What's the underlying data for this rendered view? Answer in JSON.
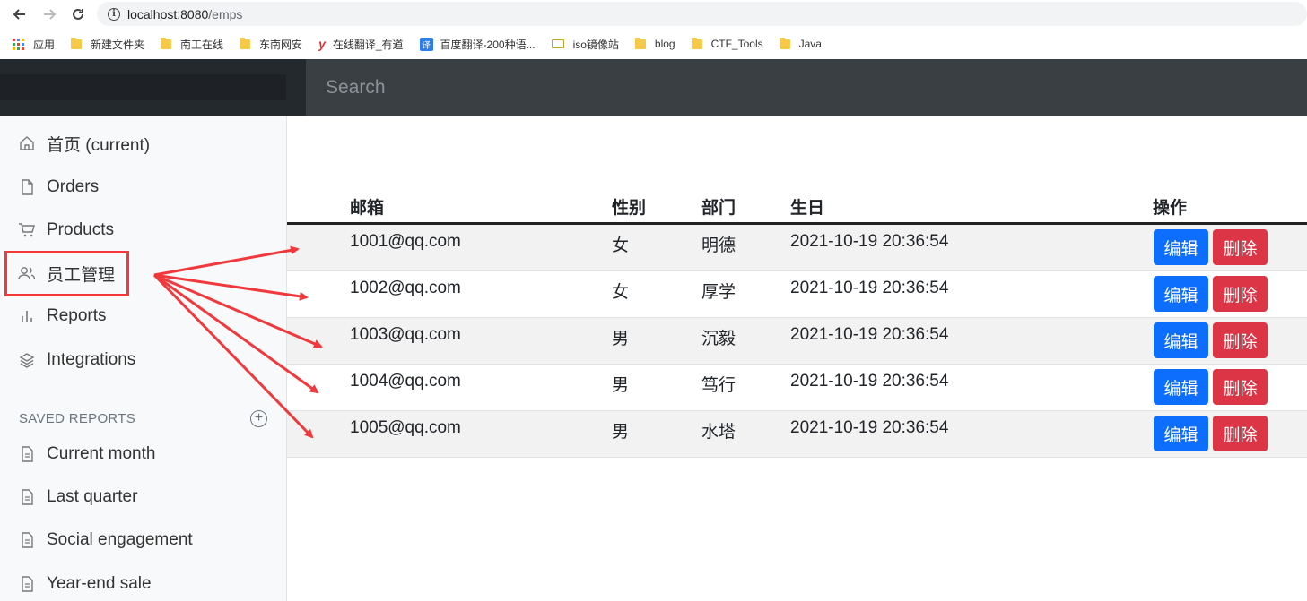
{
  "browser": {
    "url_host": "localhost:8080",
    "url_path": "/emps",
    "bookmarks": [
      {
        "label": "应用",
        "icon": "apps-grid-icon"
      },
      {
        "label": "新建文件夹",
        "icon": "folder-icon"
      },
      {
        "label": "南工在线",
        "icon": "folder-icon"
      },
      {
        "label": "东南网安",
        "icon": "folder-icon"
      },
      {
        "label": "在线翻译_有道",
        "icon": "youdao-icon"
      },
      {
        "label": "百度翻译-200种语...",
        "icon": "baidu-translate-icon"
      },
      {
        "label": "iso镜像站",
        "icon": "folder-open-icon"
      },
      {
        "label": "blog",
        "icon": "folder-icon"
      },
      {
        "label": "CTF_Tools",
        "icon": "folder-icon"
      },
      {
        "label": "Java",
        "icon": "folder-icon"
      }
    ]
  },
  "navbar": {
    "search_placeholder": "Search"
  },
  "sidebar": {
    "items": [
      {
        "label": "首页 (current)",
        "icon": "home-icon"
      },
      {
        "label": "Orders",
        "icon": "file-icon"
      },
      {
        "label": "Products",
        "icon": "cart-icon"
      },
      {
        "label": "员工管理",
        "icon": "users-icon"
      },
      {
        "label": "Reports",
        "icon": "bar-chart-icon"
      },
      {
        "label": "Integrations",
        "icon": "layers-icon"
      }
    ],
    "saved_heading": "SAVED REPORTS",
    "saved": [
      {
        "label": "Current month",
        "icon": "file-text-icon"
      },
      {
        "label": "Last quarter",
        "icon": "file-text-icon"
      },
      {
        "label": "Social engagement",
        "icon": "file-text-icon"
      },
      {
        "label": "Year-end sale",
        "icon": "file-text-icon"
      }
    ]
  },
  "table": {
    "headers": {
      "email": "邮箱",
      "gender": "性别",
      "department": "部门",
      "birth": "生日",
      "actions": "操作"
    },
    "rows": [
      {
        "email": "1001@qq.com",
        "gender": "女",
        "department": "明德",
        "birth": "2021-10-19 20:36:54"
      },
      {
        "email": "1002@qq.com",
        "gender": "女",
        "department": "厚学",
        "birth": "2021-10-19 20:36:54"
      },
      {
        "email": "1003@qq.com",
        "gender": "男",
        "department": "沉毅",
        "birth": "2021-10-19 20:36:54"
      },
      {
        "email": "1004@qq.com",
        "gender": "男",
        "department": "笃行",
        "birth": "2021-10-19 20:36:54"
      },
      {
        "email": "1005@qq.com",
        "gender": "男",
        "department": "水塔",
        "birth": "2021-10-19 20:36:54"
      }
    ],
    "edit_label": "编辑",
    "delete_label": "删除"
  },
  "colors": {
    "edit_button": "#0d6efd",
    "delete_button": "#dc3545",
    "annotation": "#f0393c",
    "navbar": "#343a40"
  }
}
